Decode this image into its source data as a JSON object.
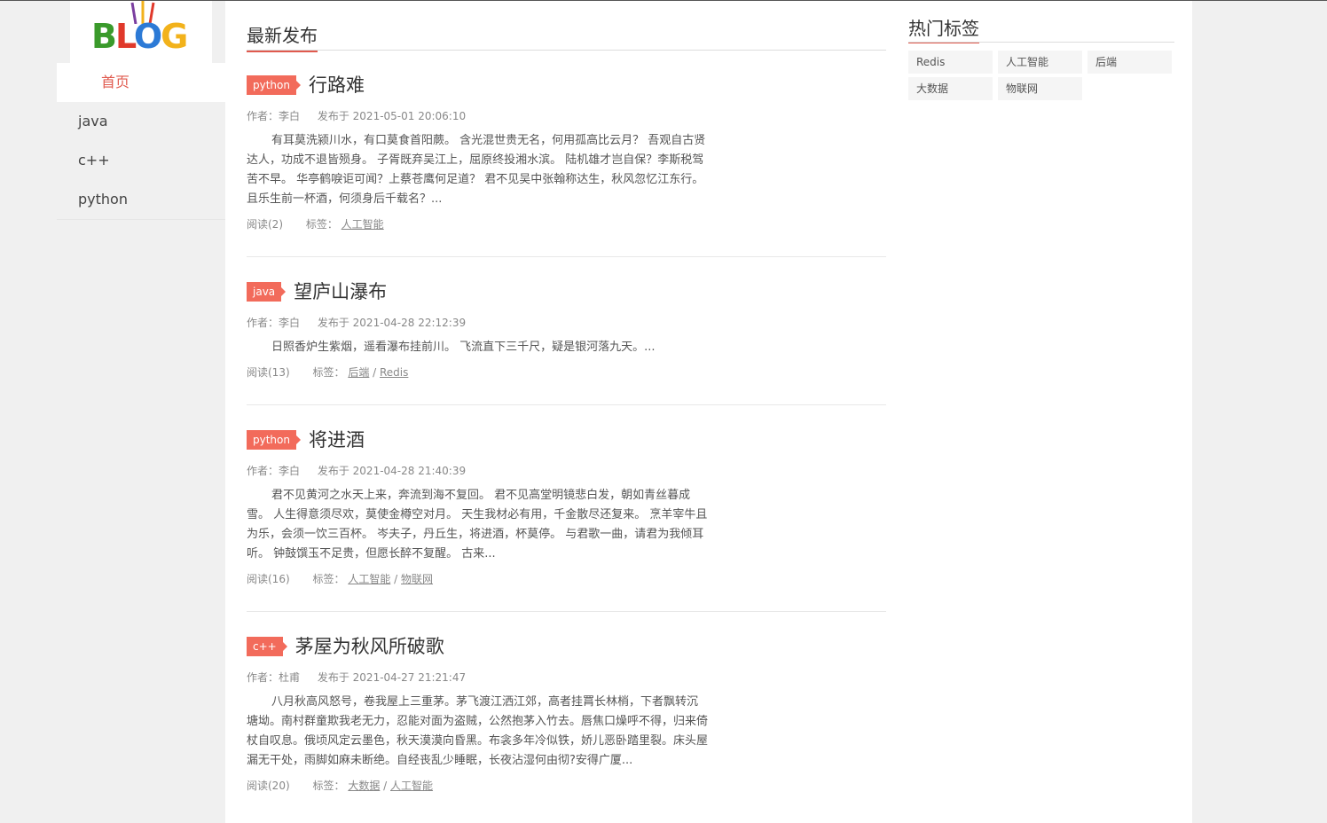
{
  "logo": {
    "text_b": "B",
    "text_l": "L",
    "text_o": "O",
    "text_g": "G",
    "icon": "blog-logo"
  },
  "nav": {
    "items": [
      {
        "label": "首页",
        "active": true
      },
      {
        "label": "java"
      },
      {
        "label": "c++"
      },
      {
        "label": "python"
      }
    ]
  },
  "main": {
    "section_title": "最新发布"
  },
  "articles": [
    {
      "category": "python",
      "title": "行路难",
      "author": "作者：李白",
      "published": "发布于 2021-05-01 20:06:10",
      "body": "有耳莫洗颍川水，有口莫食首阳蕨。 含光混世贵无名，何用孤高比云月？ 吾观自古贤达人，功成不退皆殒身。 子胥既弃吴江上，屈原终投湘水滨。 陆机雄才岂自保？李斯税驾苦不早。 华亭鹤唳讵可闻？上蔡苍鹰何足道？ 君不见吴中张翰称达生，秋风忽忆江东行。 且乐生前一杯酒，何须身后千载名？...",
      "reads": "阅读(2)",
      "tags_label": "标签：",
      "tags": [
        "人工智能"
      ]
    },
    {
      "category": "java",
      "title": "望庐山瀑布",
      "author": "作者：李白",
      "published": "发布于 2021-04-28 22:12:39",
      "body": "日照香炉生紫烟，遥看瀑布挂前川。 飞流直下三千尺，疑是银河落九天。...",
      "reads": "阅读(13)",
      "tags_label": "标签：",
      "tags": [
        "后端",
        "Redis"
      ]
    },
    {
      "category": "python",
      "title": "将进酒",
      "author": "作者：李白",
      "published": "发布于 2021-04-28 21:40:39",
      "body": "君不见黄河之水天上来，奔流到海不复回。 君不见高堂明镜悲白发，朝如青丝暮成雪。 人生得意须尽欢，莫使金樽空对月。 天生我材必有用，千金散尽还复来。 烹羊宰牛且为乐，会须一饮三百杯。 岑夫子，丹丘生，将进酒，杯莫停。 与君歌一曲，请君为我倾耳听。 钟鼓馔玉不足贵，但愿长醉不复醒。 古来...",
      "reads": "阅读(16)",
      "tags_label": "标签：",
      "tags": [
        "人工智能",
        "物联网"
      ]
    },
    {
      "category": "c++",
      "title": "茅屋为秋风所破歌",
      "author": "作者：杜甫",
      "published": "发布于 2021-04-27 21:21:47",
      "body": "八月秋高风怒号，卷我屋上三重茅。茅飞渡江洒江郊，高者挂罥长林梢，下者飘转沉塘坳。南村群童欺我老无力，忍能对面为盗贼，公然抱茅入竹去。唇焦口燥呼不得，归来倚杖自叹息。俄顷风定云墨色，秋天漠漠向昏黑。布衾多年冷似铁，娇儿恶卧踏里裂。床头屋漏无干处，雨脚如麻未断绝。自经丧乱少睡眠，长夜沾湿何由彻?安得广厦...",
      "reads": "阅读(20)",
      "tags_label": "标签：",
      "tags": [
        "大数据",
        "人工智能"
      ]
    }
  ],
  "hot": {
    "title": "热门标签",
    "tags": [
      "Redis",
      "人工智能",
      "后端",
      "大数据",
      "物联网"
    ]
  },
  "colors": {
    "accent": "#e05a4e",
    "badge": "#f26b5b"
  }
}
